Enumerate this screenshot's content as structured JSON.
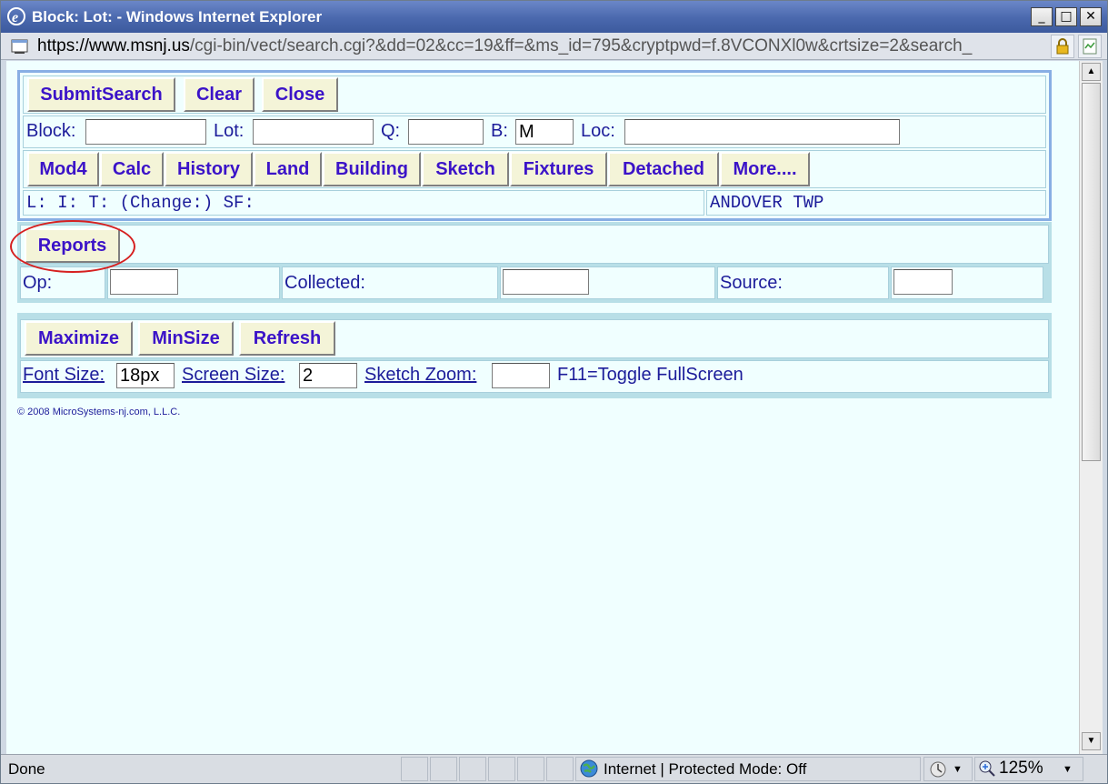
{
  "window": {
    "title": "Block: Lot: - Windows Internet Explorer",
    "address": {
      "scheme": "https://www.",
      "host": "msnj.us",
      "path": "/cgi-bin/vect/search.cgi?&dd=02&cc=19&ff=&ms_id=795&cryptpwd=f.8VCONXl0w&crtsize=2&search_"
    },
    "controls": {
      "minimize": "_",
      "maximize": "□",
      "close": "✕"
    }
  },
  "toolbar1": {
    "submit_label": "SubmitSearch",
    "clear_label": "Clear",
    "close_label": "Close"
  },
  "search": {
    "block_label": "Block:",
    "block_value": "",
    "lot_label": "Lot:",
    "lot_value": "",
    "q_label": "Q:",
    "q_value": "",
    "b_label": "B:",
    "b_value": "M",
    "loc_label": "Loc:",
    "loc_value": ""
  },
  "toolbar2": {
    "items": [
      "Mod4",
      "Calc",
      "History",
      "Land",
      "Building",
      "Sketch",
      "Fixtures",
      "Detached",
      "More...."
    ]
  },
  "info": {
    "lit_text": "L: I: T: (Change:) SF:",
    "town_text": "ANDOVER TWP"
  },
  "reports": {
    "reports_label": "Reports",
    "op_label": "Op:",
    "op_value": "",
    "collected_label": "Collected:",
    "collected_value": "",
    "source_label": "Source:",
    "source_value": ""
  },
  "settings": {
    "maximize_label": "Maximize",
    "minsize_label": "MinSize",
    "refresh_label": "Refresh",
    "font_size_label": "Font Size:",
    "font_size_value": "18px",
    "screen_size_label": "Screen Size:",
    "screen_size_value": "2",
    "sketch_zoom_label": "Sketch Zoom:",
    "sketch_zoom_value": "",
    "fullscreen_hint": "F11=Toggle FullScreen"
  },
  "copyright": "© 2008 MicroSystems-nj.com, L.L.C.",
  "status": {
    "left_text": "Done",
    "zone_text": "Internet | Protected Mode: Off",
    "zoom_text": "125%"
  },
  "colors": {
    "button_text": "#3b13c8",
    "label_text": "#1c1c9a",
    "page_bg": "#f0ffff",
    "highlight_circle": "#d62020"
  }
}
